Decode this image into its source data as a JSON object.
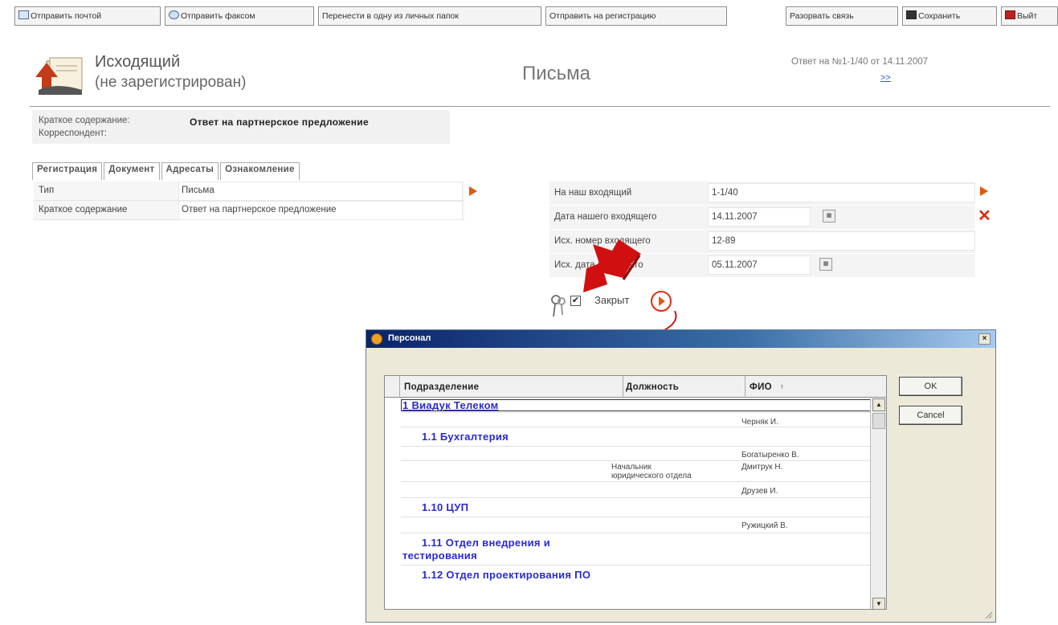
{
  "toolbar": {
    "send_mail": "Отправить почтой",
    "send_fax": "Отправить факсом",
    "move_folder": "Перенести в одну из личных папок",
    "send_reg": "Отправить на регистрацию",
    "break_link": "Разорвать связь",
    "save": "Сохранить",
    "exit": "Выйт"
  },
  "header": {
    "title": "Исходящий",
    "subtitle": "(не зарегистрирован)",
    "center_title": "Письма",
    "reply_text": "Ответ на №1-1/40 от 14.11.2007",
    "reply_link": ">>"
  },
  "summary": {
    "brief_label": "Краткое содержание:",
    "brief_value": "Ответ на партнерское предложение",
    "correspondent_label": "Корреспондент:"
  },
  "tabs": [
    "Регистрация",
    "Документ",
    "Адресаты",
    "Ознакомление"
  ],
  "left_fields": [
    {
      "label": "Тип",
      "value": "Письма"
    },
    {
      "label": "Краткое содержание",
      "value": "Ответ на партнерское предложение"
    }
  ],
  "right_fields": [
    {
      "label": "На наш входящий",
      "value": "1-1/40"
    },
    {
      "label": "Дата нашего входящего",
      "value": "14.11.2007"
    },
    {
      "label": "Исх. номер входящего",
      "value": "12-89"
    },
    {
      "label": "Исх. дата входящего",
      "value": "05.11.2007"
    }
  ],
  "closed": {
    "label": "Закрыт",
    "checked_mark": "✔"
  },
  "dialog": {
    "title": "Персонал",
    "columns": [
      "Подразделение",
      "Должность",
      "ФИО"
    ],
    "sort_mark": "↑",
    "rows": [
      {
        "dept": "1 Виадук Телеком",
        "position": "",
        "name": ""
      },
      {
        "dept": "",
        "position": "",
        "name": "Черняк И."
      },
      {
        "dept": "1.1 Бухгалтерия",
        "position": "",
        "name": ""
      },
      {
        "dept": "",
        "position": "",
        "name": "Богатыренко В."
      },
      {
        "dept": "",
        "position": "Начальник юридического отдела",
        "name": "Дмитрук Н."
      },
      {
        "dept": "",
        "position": "",
        "name": "Друзев И."
      },
      {
        "dept": "1.10 ЦУП",
        "position": "",
        "name": ""
      },
      {
        "dept": "",
        "position": "",
        "name": "Ружицкий В."
      },
      {
        "dept": "1.11 Отдел внедрения и тестирования",
        "position": "",
        "name": ""
      },
      {
        "dept": "1.12 Отдел проектирования ПО",
        "position": "",
        "name": ""
      }
    ],
    "ok": "OK",
    "cancel": "Cancel",
    "close": "×"
  },
  "colors": {
    "accent_red": "#e03010",
    "link_blue": "#2a2ad0",
    "title_bar": "#0a246a"
  },
  "icons": [
    "mail-icon",
    "fax-icon",
    "save-icon",
    "exit-icon",
    "document-icon",
    "arrow-right-icon",
    "delete-x-icon",
    "calendar-icon",
    "keys-icon",
    "checkbox-icon"
  ]
}
